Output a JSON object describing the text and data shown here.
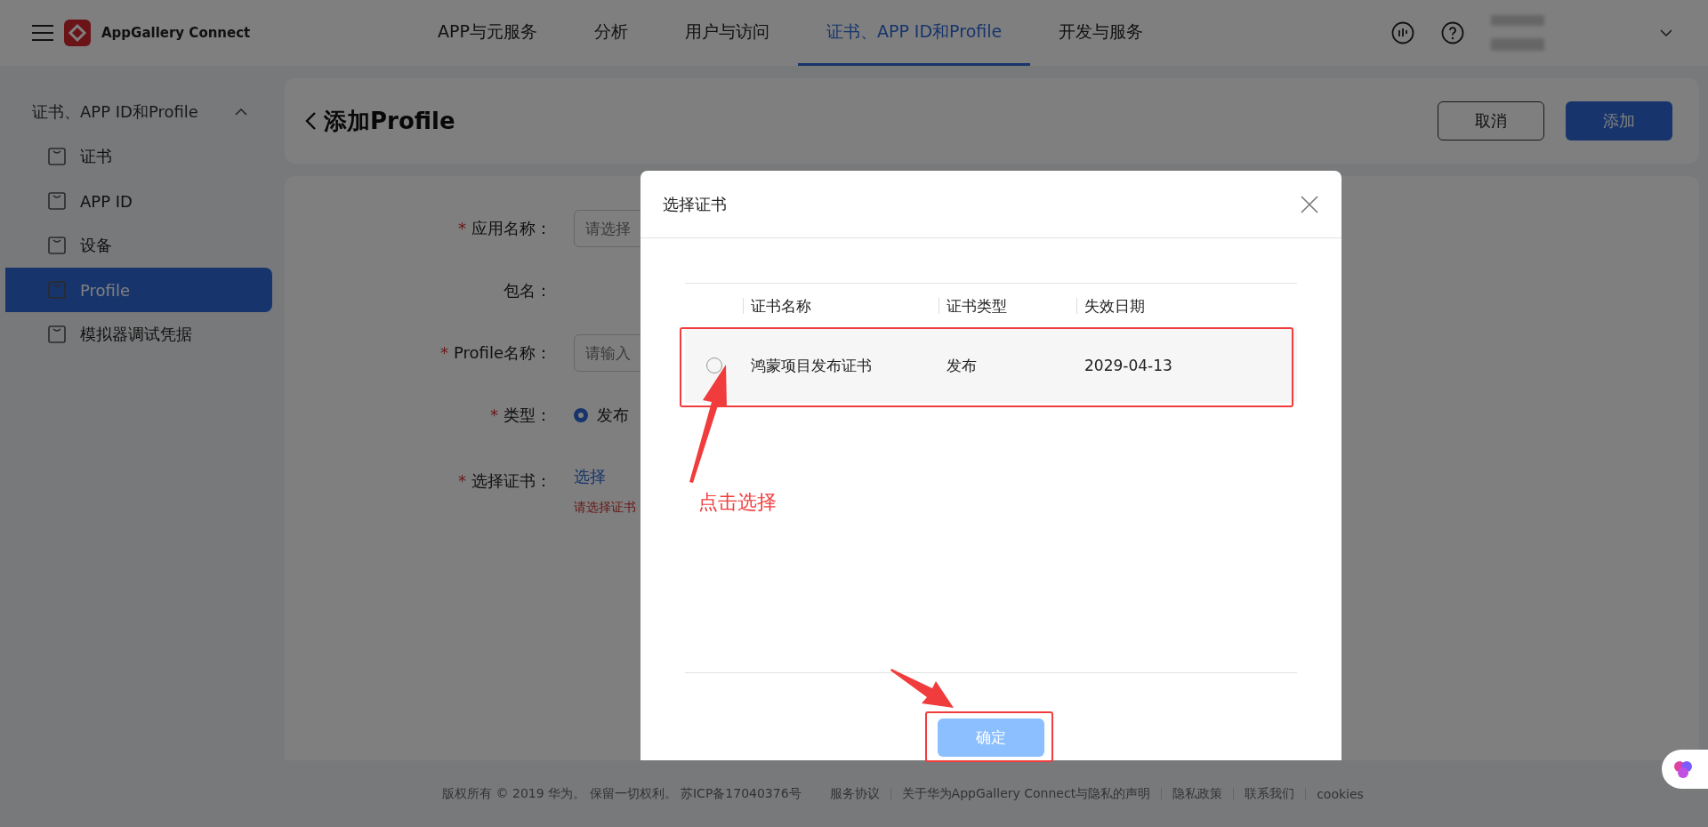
{
  "header": {
    "logo_text": "AppGallery Connect",
    "nav": [
      {
        "label": "APP与元服务",
        "selected": false
      },
      {
        "label": "分析",
        "selected": false
      },
      {
        "label": "用户与访问",
        "selected": false
      },
      {
        "label": "证书、APP ID和Profile",
        "selected": true
      },
      {
        "label": "开发与服务",
        "selected": false
      }
    ]
  },
  "sidebar": {
    "group": {
      "label": "证书、APP ID和Profile",
      "expanded": true
    },
    "items": [
      {
        "label": "证书",
        "selected": false
      },
      {
        "label": "APP ID",
        "selected": false
      },
      {
        "label": "设备",
        "selected": false
      },
      {
        "label": "Profile",
        "selected": true
      },
      {
        "label": "模拟器调试凭据",
        "selected": false
      }
    ]
  },
  "page": {
    "title": "添加Profile",
    "buttons": [
      {
        "label": "取消",
        "kind": "secondary"
      },
      {
        "label": "添加",
        "kind": "primary"
      }
    ]
  },
  "form": {
    "fields": [
      {
        "label": "应用名称：",
        "required_mark": "*",
        "kind": "input",
        "placeholder": "请选择"
      },
      {
        "label": "包名：",
        "kind": "text"
      },
      {
        "label": "Profile名称：",
        "required_mark": "*",
        "kind": "input",
        "placeholder": "请输入"
      },
      {
        "label": "类型：",
        "required_mark": "*",
        "kind": "radio",
        "option": "发布",
        "selected": true
      },
      {
        "label": "选择证书：",
        "required_mark": "*",
        "kind": "link",
        "link": "选择",
        "error": "请选择证书"
      }
    ]
  },
  "modal": {
    "title": "选择证书",
    "columns": [
      "证书名称",
      "证书类型",
      "失效日期"
    ],
    "rows": [
      {
        "selected": false,
        "cells": [
          "鸿蒙项目发布证书",
          "发布",
          "2029-04-13"
        ]
      }
    ],
    "confirm": {
      "label": "确定",
      "disabled": true
    }
  },
  "annotation": {
    "label": "点击选择"
  },
  "footer": {
    "copyright": "版权所有 © 2019 华为。 保留一切权利。 苏ICP备17040376号",
    "links": [
      "服务协议",
      "关于华为AppGallery Connect与隐私的声明",
      "隐私政策",
      "联系我们",
      "cookies"
    ]
  }
}
